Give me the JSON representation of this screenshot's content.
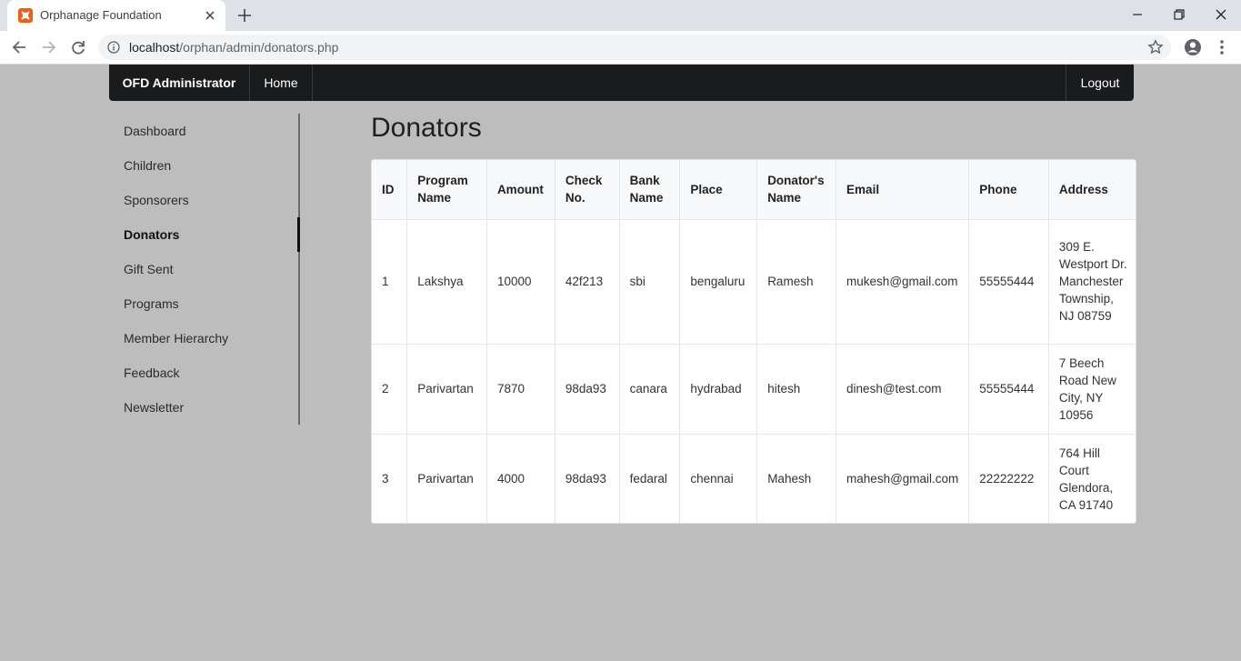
{
  "browser": {
    "tab_title": "Orphanage Foundation",
    "url_host": "localhost",
    "url_path": "/orphan/admin/donators.php"
  },
  "navbar": {
    "brand": "OFD Administrator",
    "home": "Home",
    "logout": "Logout"
  },
  "sidebar": {
    "items": [
      {
        "label": "Dashboard"
      },
      {
        "label": "Children"
      },
      {
        "label": "Sponsorers"
      },
      {
        "label": "Donators",
        "active": true
      },
      {
        "label": "Gift Sent"
      },
      {
        "label": "Programs"
      },
      {
        "label": "Member Hierarchy"
      },
      {
        "label": "Feedback"
      },
      {
        "label": "Newsletter"
      }
    ]
  },
  "main": {
    "title": "Donators",
    "table": {
      "headers": [
        "ID",
        "Program Name",
        "Amount",
        "Check No.",
        "Bank Name",
        "Place",
        "Donator's Name",
        "Email",
        "Phone",
        "Address"
      ],
      "rows": [
        [
          "1",
          "Lakshya",
          "10000",
          "42f213",
          "sbi",
          "bengaluru",
          "Ramesh",
          "mukesh@gmail.com",
          "55555444",
          "309 E. Westport Dr. Manchester Township, NJ 08759"
        ],
        [
          "2",
          "Parivartan",
          "7870",
          "98da93",
          "canara",
          "hydrabad",
          "hitesh",
          "dinesh@test.com",
          "55555444",
          "7 Beech Road New City, NY 10956"
        ],
        [
          "3",
          "Parivartan",
          "4000",
          "98da93",
          "fedaral",
          "chennai",
          "Mahesh",
          "mahesh@gmail.com",
          "22222222",
          "764 Hill Court Glendora, CA 91740"
        ]
      ]
    }
  },
  "colors": {
    "page_bg": "#bdbdbd",
    "navbar_bg": "#1a1b1d",
    "favicon": "#e8601c"
  }
}
